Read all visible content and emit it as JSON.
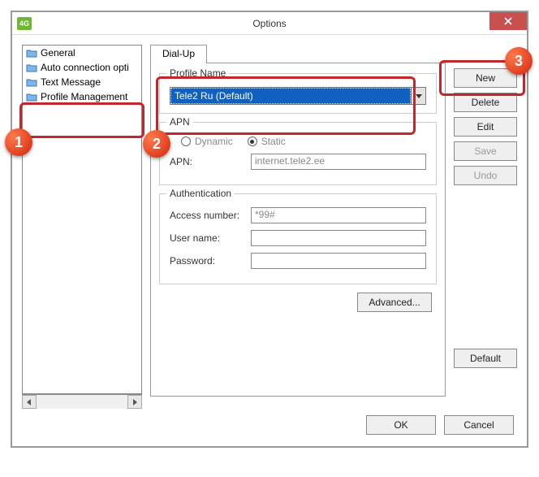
{
  "window": {
    "badge": "4G",
    "title": "Options"
  },
  "sidebar": {
    "items": [
      {
        "label": "General"
      },
      {
        "label": "Auto connection opti"
      },
      {
        "label": "Text Message"
      },
      {
        "label": "Profile Management"
      }
    ]
  },
  "tabs": {
    "dialup": "Dial-Up"
  },
  "profile": {
    "group_label": "Profile Name",
    "selected": "Tele2 Ru (Default)"
  },
  "apn": {
    "group_label": "APN",
    "dynamic": "Dynamic",
    "static": "Static",
    "apn_label": "APN:",
    "apn_value": "internet.tele2.ee"
  },
  "auth": {
    "group_label": "Authentication",
    "access": "Access number:",
    "access_value": "*99#",
    "user": "User name:",
    "pass": "Password:"
  },
  "buttons": {
    "new": "New",
    "delete": "Delete",
    "edit": "Edit",
    "save": "Save",
    "undo": "Undo",
    "default": "Default",
    "advanced": "Advanced...",
    "ok": "OK",
    "cancel": "Cancel"
  },
  "callouts": {
    "one": "1",
    "two": "2",
    "three": "3"
  }
}
